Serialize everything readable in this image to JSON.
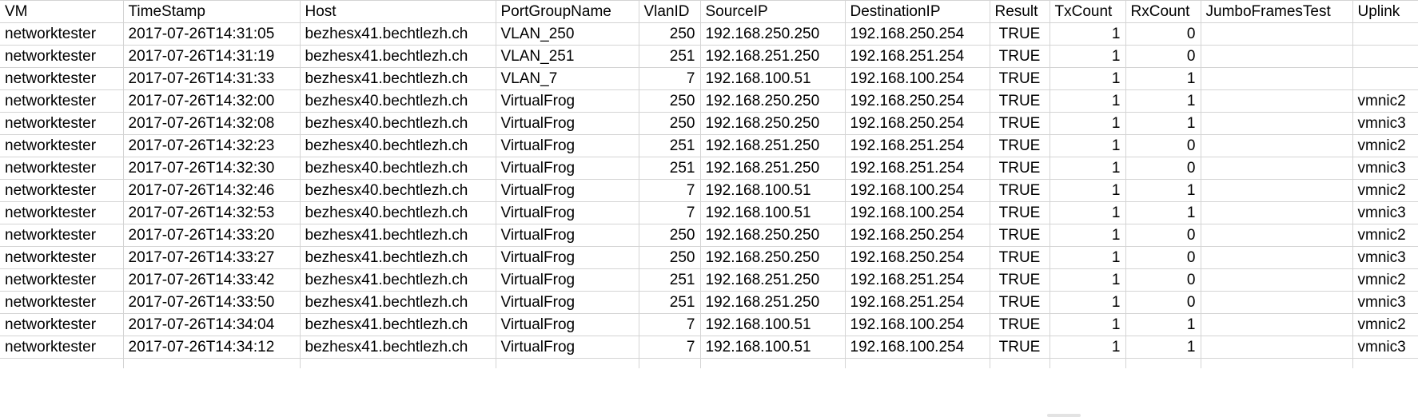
{
  "sheet": {
    "columns": [
      "VM",
      "TimeStamp",
      "Host",
      "PortGroupName",
      "VlanID",
      "SourceIP",
      "DestinationIP",
      "Result",
      "TxCount",
      "RxCount",
      "JumboFramesTest",
      "Uplink"
    ],
    "rows": [
      [
        "networktester",
        "2017-07-26T14:31:05",
        "bezhesx41.bechtlezh.ch",
        "VLAN_250",
        "250",
        "192.168.250.250",
        "192.168.250.254",
        "TRUE",
        "1",
        "0",
        "",
        ""
      ],
      [
        "networktester",
        "2017-07-26T14:31:19",
        "bezhesx41.bechtlezh.ch",
        "VLAN_251",
        "251",
        "192.168.251.250",
        "192.168.251.254",
        "TRUE",
        "1",
        "0",
        "",
        ""
      ],
      [
        "networktester",
        "2017-07-26T14:31:33",
        "bezhesx41.bechtlezh.ch",
        "VLAN_7",
        "7",
        "192.168.100.51",
        "192.168.100.254",
        "TRUE",
        "1",
        "1",
        "",
        ""
      ],
      [
        "networktester",
        "2017-07-26T14:32:00",
        "bezhesx40.bechtlezh.ch",
        "VirtualFrog",
        "250",
        "192.168.250.250",
        "192.168.250.254",
        "TRUE",
        "1",
        "1",
        "",
        "vmnic2"
      ],
      [
        "networktester",
        "2017-07-26T14:32:08",
        "bezhesx40.bechtlezh.ch",
        "VirtualFrog",
        "250",
        "192.168.250.250",
        "192.168.250.254",
        "TRUE",
        "1",
        "1",
        "",
        "vmnic3"
      ],
      [
        "networktester",
        "2017-07-26T14:32:23",
        "bezhesx40.bechtlezh.ch",
        "VirtualFrog",
        "251",
        "192.168.251.250",
        "192.168.251.254",
        "TRUE",
        "1",
        "0",
        "",
        "vmnic2"
      ],
      [
        "networktester",
        "2017-07-26T14:32:30",
        "bezhesx40.bechtlezh.ch",
        "VirtualFrog",
        "251",
        "192.168.251.250",
        "192.168.251.254",
        "TRUE",
        "1",
        "0",
        "",
        "vmnic3"
      ],
      [
        "networktester",
        "2017-07-26T14:32:46",
        "bezhesx40.bechtlezh.ch",
        "VirtualFrog",
        "7",
        "192.168.100.51",
        "192.168.100.254",
        "TRUE",
        "1",
        "1",
        "",
        "vmnic2"
      ],
      [
        "networktester",
        "2017-07-26T14:32:53",
        "bezhesx40.bechtlezh.ch",
        "VirtualFrog",
        "7",
        "192.168.100.51",
        "192.168.100.254",
        "TRUE",
        "1",
        "1",
        "",
        "vmnic3"
      ],
      [
        "networktester",
        "2017-07-26T14:33:20",
        "bezhesx41.bechtlezh.ch",
        "VirtualFrog",
        "250",
        "192.168.250.250",
        "192.168.250.254",
        "TRUE",
        "1",
        "0",
        "",
        "vmnic2"
      ],
      [
        "networktester",
        "2017-07-26T14:33:27",
        "bezhesx41.bechtlezh.ch",
        "VirtualFrog",
        "250",
        "192.168.250.250",
        "192.168.250.254",
        "TRUE",
        "1",
        "0",
        "",
        "vmnic3"
      ],
      [
        "networktester",
        "2017-07-26T14:33:42",
        "bezhesx41.bechtlezh.ch",
        "VirtualFrog",
        "251",
        "192.168.251.250",
        "192.168.251.254",
        "TRUE",
        "1",
        "0",
        "",
        "vmnic2"
      ],
      [
        "networktester",
        "2017-07-26T14:33:50",
        "bezhesx41.bechtlezh.ch",
        "VirtualFrog",
        "251",
        "192.168.251.250",
        "192.168.251.254",
        "TRUE",
        "1",
        "0",
        "",
        "vmnic3"
      ],
      [
        "networktester",
        "2017-07-26T14:34:04",
        "bezhesx41.bechtlezh.ch",
        "VirtualFrog",
        "7",
        "192.168.100.51",
        "192.168.100.254",
        "TRUE",
        "1",
        "1",
        "",
        "vmnic2"
      ],
      [
        "networktester",
        "2017-07-26T14:34:12",
        "bezhesx41.bechtlezh.ch",
        "VirtualFrog",
        "7",
        "192.168.100.51",
        "192.168.100.254",
        "TRUE",
        "1",
        "1",
        "",
        "vmnic3"
      ]
    ]
  }
}
